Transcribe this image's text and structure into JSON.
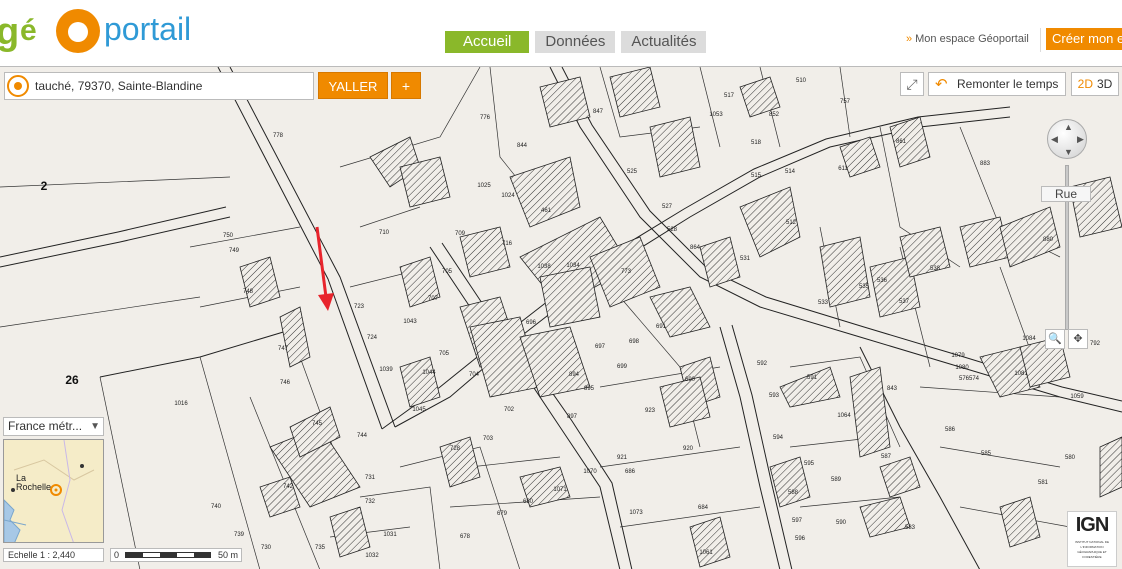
{
  "header": {
    "logo_text": "géoportail",
    "nav_tabs": [
      {
        "label": "Accueil",
        "active": true
      },
      {
        "label": "Données",
        "active": false
      },
      {
        "label": "Actualités",
        "active": false
      }
    ],
    "mon_espace": "Mon espace Géoportail",
    "creer_button": "Créer mon e"
  },
  "search": {
    "value": "tauché, 79370, Sainte-Blandine",
    "go_label": "YALLER",
    "plus_label": "+"
  },
  "controls": {
    "time_label": "Remonter le temps",
    "mode_2d": "2D",
    "mode_3d": "3D",
    "zoom_label": "Rue"
  },
  "overview": {
    "region": "France métr...",
    "city": "La\nRochelle"
  },
  "scale": {
    "text": "Echelle 1 :  2,440",
    "start": "0",
    "end": "50 m"
  },
  "ign": {
    "logo": "IGN",
    "subtitle": "INSTITUT NATIONAL DE L'INFORMATION GÉOGRAPHIQUE ET FORESTIÈRE"
  },
  "map_labels": {
    "sections": [
      "2",
      "26"
    ],
    "parcels": [
      "778",
      "776",
      "844",
      "847",
      "1025",
      "1024",
      "461",
      "710",
      "709",
      "716",
      "705",
      "750",
      "749",
      "748",
      "723",
      "724",
      "707",
      "1043",
      "747",
      "746",
      "1039",
      "1044",
      "1045",
      "1016",
      "745",
      "744",
      "728",
      "731",
      "732",
      "742",
      "740",
      "739",
      "730",
      "735",
      "1032",
      "1031",
      "678",
      "679",
      "680",
      "1071",
      "1070",
      "921",
      "686",
      "1073",
      "684",
      "920",
      "1061",
      "897",
      "894",
      "895",
      "702",
      "703",
      "704",
      "705",
      "773",
      "1038",
      "1034",
      "696",
      "697",
      "698",
      "699",
      "691",
      "690",
      "923",
      "525",
      "527",
      "528",
      "864",
      "518",
      "515",
      "514",
      "512",
      "531",
      "517",
      "1053",
      "852",
      "510",
      "757",
      "533",
      "535",
      "536",
      "537",
      "538",
      "592",
      "591",
      "593",
      "594",
      "595",
      "589",
      "590",
      "588",
      "597",
      "596",
      "1064",
      "843",
      "587",
      "583",
      "586",
      "585",
      "581",
      "580",
      "1079",
      "1080",
      "574",
      "576",
      "1084",
      "1081",
      "1059",
      "883",
      "880",
      "861",
      "611",
      "792",
      "2"
    ]
  },
  "colors": {
    "accent_orange": "#f08a00",
    "nav_green": "#8ab82a",
    "marker_red": "#e8242c",
    "map_background": "#f1eee9"
  }
}
